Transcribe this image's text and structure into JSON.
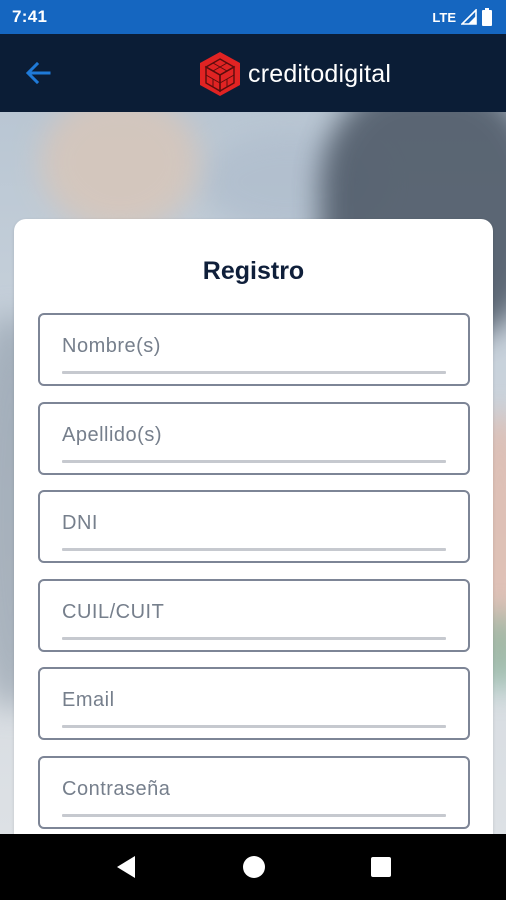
{
  "status_bar": {
    "time": "7:41",
    "network": "LTE"
  },
  "header": {
    "back_icon": "arrow-left-icon",
    "brand": "creditodigital",
    "logo_icon": "hexagon-cube-logo",
    "accent_color": "#1f7ad8",
    "logo_color": "#e02323"
  },
  "form": {
    "title": "Registro",
    "fields": [
      {
        "placeholder": "Nombre(s)",
        "value": ""
      },
      {
        "placeholder": "Apellido(s)",
        "value": ""
      },
      {
        "placeholder": "DNI",
        "value": ""
      },
      {
        "placeholder": "CUIL/CUIT",
        "value": ""
      },
      {
        "placeholder": "Email",
        "value": ""
      },
      {
        "placeholder": "Contraseña",
        "value": ""
      }
    ]
  },
  "nav_bar": {
    "back_icon": "triangle-back-icon",
    "home_icon": "circle-home-icon",
    "recents_icon": "square-recents-icon"
  }
}
